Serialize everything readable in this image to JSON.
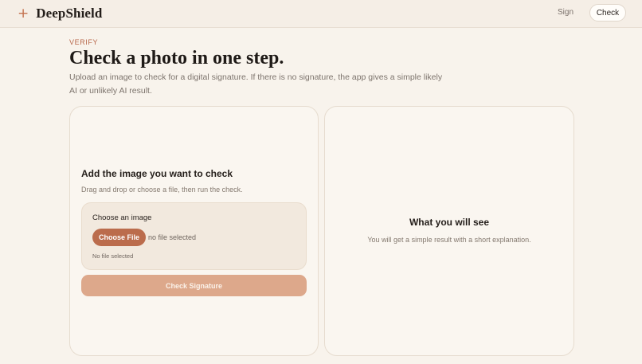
{
  "header": {
    "brand_icon": "+",
    "brand_name": "DeepShield",
    "nav": {
      "sign_label": "Sign",
      "check_label": "Check"
    }
  },
  "hero": {
    "eyebrow": "VERIFY",
    "title": "Check a photo in one step.",
    "description": "Upload an image to check for a digital signature. If there is no signature, the app gives a simple likely AI or unlikely AI result."
  },
  "upload_card": {
    "title": "Add the image you want to check",
    "subtitle": "Drag and drop or choose a file, then run the check.",
    "field_label": "Choose an image",
    "choose_button": "Choose File",
    "file_status": "no file selected",
    "file_note": "No file selected",
    "submit_button": "Check Signature"
  },
  "result_card": {
    "title": "What you will see",
    "subtitle": "You will get a simple result with a short explanation."
  },
  "colors": {
    "background": "#f8f3ec",
    "accent": "#bb6c4c",
    "accent_disabled": "#dda88b",
    "brand_plus": "#c4724f"
  }
}
